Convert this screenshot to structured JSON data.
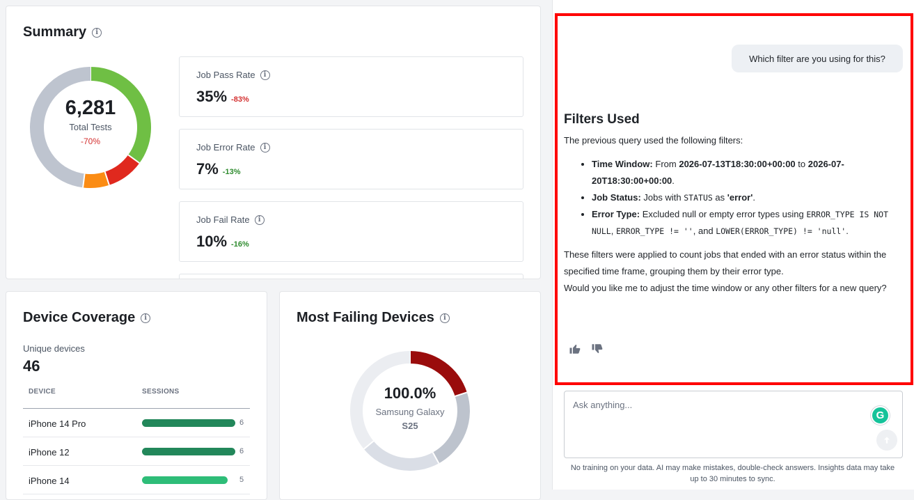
{
  "summary": {
    "title": "Summary",
    "total_value": "6,281",
    "total_label": "Total Tests",
    "total_delta": "-70%",
    "donut_segments": [
      {
        "name": "pass",
        "value": 35,
        "color": "#6fbf44"
      },
      {
        "name": "error",
        "value": 10,
        "color": "#e0291e"
      },
      {
        "name": "fail",
        "value": 7,
        "color": "#fb8c14"
      },
      {
        "name": "other",
        "value": 48,
        "color": "#bec4cf"
      }
    ],
    "metrics": [
      {
        "label": "Job Pass Rate",
        "value": "35%",
        "delta": "-83%",
        "trend": "neg"
      },
      {
        "label": "Job Error Rate",
        "value": "7%",
        "delta": "-13%",
        "trend": "pos"
      },
      {
        "label": "Job Fail Rate",
        "value": "10%",
        "delta": "-16%",
        "trend": "pos"
      }
    ]
  },
  "device_coverage": {
    "title": "Device Coverage",
    "unique_label": "Unique devices",
    "unique_value": "46",
    "col_device": "DEVICE",
    "col_sessions": "SESSIONS",
    "rows": [
      {
        "device": "iPhone 14 Pro",
        "sessions": "6",
        "fill": 1.0,
        "color": "#22875a"
      },
      {
        "device": "iPhone 12",
        "sessions": "6",
        "fill": 1.0,
        "color": "#22875a"
      },
      {
        "device": "iPhone 14",
        "sessions": "5",
        "fill": 0.92,
        "color": "#2ebd78"
      }
    ]
  },
  "most_failing": {
    "title": "Most Failing Devices",
    "center_value": "100.0%",
    "center_label_1": "Samsung Galaxy",
    "center_label_2": "S25",
    "donut_segments": [
      {
        "value": 20,
        "color": "#9a0c0c"
      },
      {
        "value": 22,
        "color": "#bdc3cd"
      },
      {
        "value": 22,
        "color": "#dadee6"
      },
      {
        "value": 36,
        "color": "#ebedf1"
      }
    ]
  },
  "chat": {
    "user_message": "Which filter are you using for this?",
    "response_title": "Filters Used",
    "intro": "The previous query used the following filters:",
    "bullets": [
      {
        "label": "Time Window:",
        "pre": "From",
        "from": "2026-07-13T18:30:00+00:00",
        "mid": "to",
        "to": "2026-07-20T18:30:00+00:00",
        "post": "."
      },
      {
        "label": "Job Status:",
        "pre": "Jobs with",
        "code": "STATUS",
        "mid": "as",
        "bold": "'error'",
        "post": "."
      },
      {
        "label": "Error Type:",
        "pre": "Excluded null or empty error types using",
        "code1": "ERROR_TYPE IS NOT NULL",
        "sep1": ",",
        "code2": "ERROR_TYPE != ''",
        "sep2": ", and",
        "code3": "LOWER(ERROR_TYPE) != 'null'",
        "post": "."
      }
    ],
    "para1": "These filters were applied to count jobs that ended with an error status within the specified time frame, grouping them by their error type.",
    "para2": "Would you like me to adjust the time window or any other filters for a new query?",
    "input_placeholder": "Ask anything...",
    "disclaimer": "No training on your data. AI may make mistakes, double-check answers. Insights data may take up to 30 minutes to sync."
  }
}
